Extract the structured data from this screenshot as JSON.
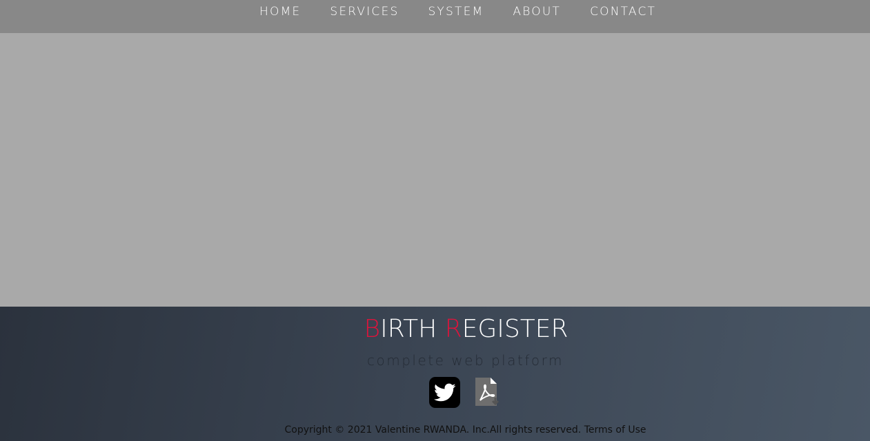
{
  "nav": {
    "items": [
      {
        "label": "HOME"
      },
      {
        "label": "SERVICES"
      },
      {
        "label": "SYSTEM"
      },
      {
        "label": "ABOUT"
      },
      {
        "label": "CONTACT"
      }
    ]
  },
  "footer": {
    "brand": {
      "word1_initial": "B",
      "word1_rest": "IRTH ",
      "word2_initial": "R",
      "word2_rest": "EGISTER"
    },
    "tagline": "complete web platform",
    "social": {
      "twitter_icon": "twitter-icon",
      "pdf_icon": "pdf-download-icon"
    },
    "copyright": "Copyright © 2021 Valentine RWANDA. Inc.All rights reserved.",
    "terms_label": "Terms of Use"
  },
  "colors": {
    "accent": "#dc143c",
    "navbar": "#888888",
    "hero": "#a9a9a9",
    "footer_start": "#2b323d",
    "footer_end": "#4a5766"
  }
}
